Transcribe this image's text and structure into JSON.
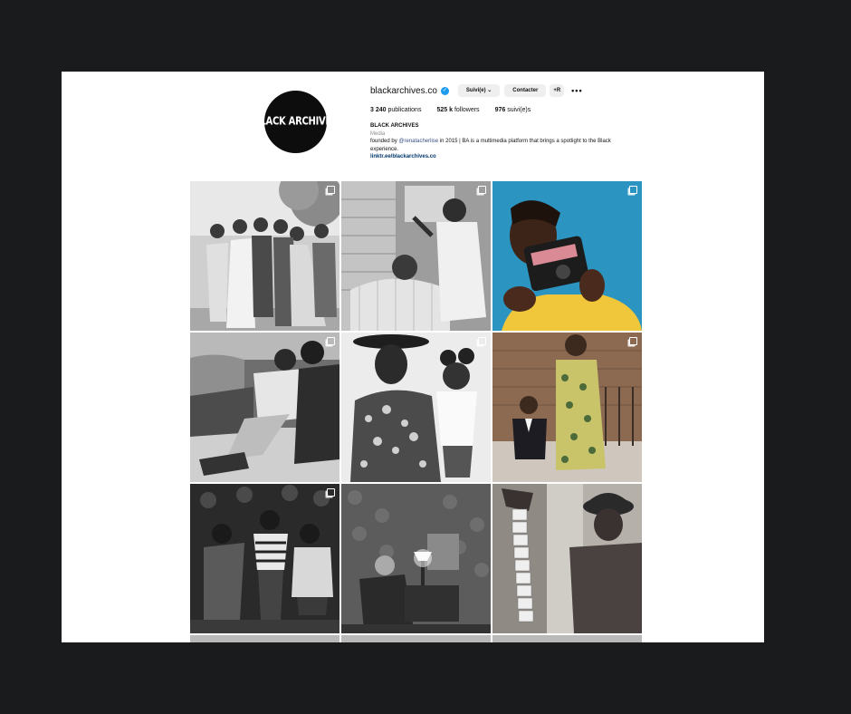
{
  "profile": {
    "avatar_text": "BLACK ARCHIVES",
    "username": "blackarchives.co",
    "verified_icon": "verified-badge-icon",
    "follow_button": "Suivi(e)",
    "follow_chevron": "chevron-down-icon",
    "contact_button": "Contacter",
    "suggest_button": "+R",
    "more_icon": "•••",
    "stats": {
      "posts_count": "3 240",
      "posts_label": "publications",
      "followers_count": "525 k",
      "followers_label": "followers",
      "following_count": "976",
      "following_label": "suivi(e)s"
    },
    "bio": {
      "name": "BLACK ARCHIVES",
      "category": "Media",
      "text_before": "founded by ",
      "mention": "@renatacherlise",
      "text_after": " in 2015 | BA is a multimedia platform that brings a spotlight to the Black experience.",
      "link": "linktr.ee/blackarchives.co"
    }
  },
  "posts": [
    {
      "type": "multi",
      "tone": "bw"
    },
    {
      "type": "multi",
      "tone": "bw"
    },
    {
      "type": "multi",
      "tone": "color"
    },
    {
      "type": "multi",
      "tone": "bw"
    },
    {
      "type": "multi",
      "tone": "bw"
    },
    {
      "type": "multi",
      "tone": "color"
    },
    {
      "type": "multi",
      "tone": "bw"
    },
    {
      "type": "single",
      "tone": "bw"
    },
    {
      "type": "single",
      "tone": "bw"
    }
  ],
  "colors": {
    "background": "#1a1b1d",
    "page": "#ffffff",
    "verified": "#1d9bf0",
    "mention": "#385185",
    "link": "#00376b"
  }
}
